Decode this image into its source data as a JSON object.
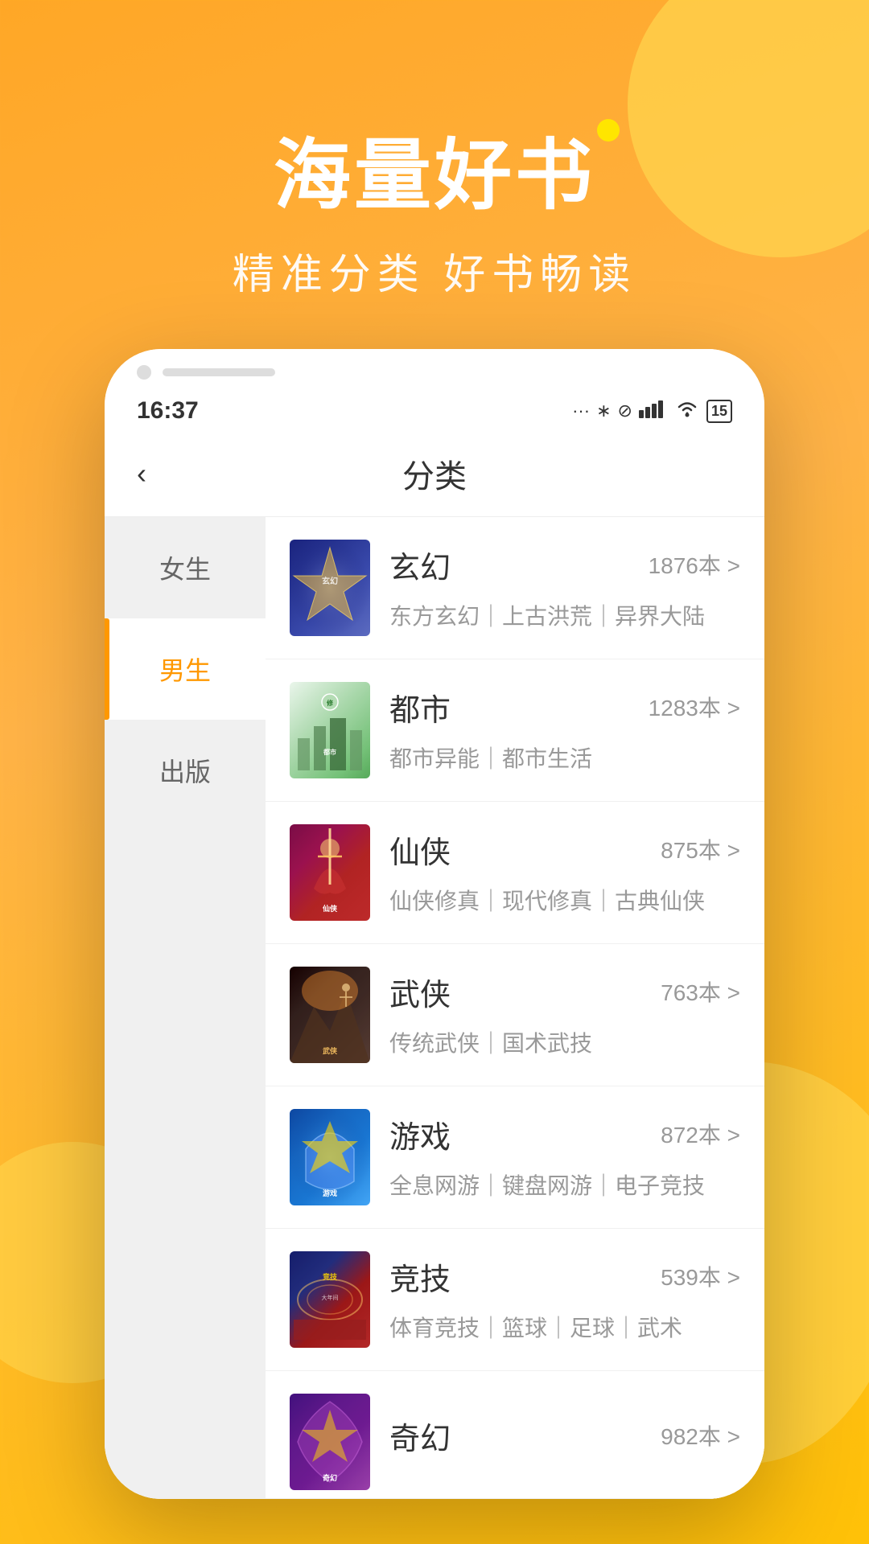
{
  "background": {
    "gradient_start": "#FFA726",
    "gradient_end": "#FFC107",
    "accent_yellow": "#FFD54F"
  },
  "header": {
    "main_title": "海量好书",
    "sub_title": "精准分类 好书畅读"
  },
  "status_bar": {
    "time": "16:37",
    "battery": "15"
  },
  "nav": {
    "back_label": "‹",
    "title": "分类"
  },
  "sidebar": {
    "items": [
      {
        "id": "female",
        "label": "女生",
        "active": false
      },
      {
        "id": "male",
        "label": "男生",
        "active": true
      },
      {
        "id": "publish",
        "label": "出版",
        "active": false
      }
    ]
  },
  "categories": [
    {
      "id": "xuanhuan",
      "name": "玄幻",
      "count": "1876本 >",
      "tags": "东方玄幻｜上古洪荒｜异界大陆",
      "cover_type": "xuanhuan",
      "cover_text": "玄幻"
    },
    {
      "id": "dushi",
      "name": "都市",
      "count": "1283本 >",
      "tags": "都市异能｜都市生活",
      "cover_type": "dushi",
      "cover_text": "都市"
    },
    {
      "id": "xianxia",
      "name": "仙侠",
      "count": "875本 >",
      "tags": "仙侠修真｜现代修真｜古典仙侠",
      "cover_type": "xianxia",
      "cover_text": "仙侠"
    },
    {
      "id": "wuxia",
      "name": "武侠",
      "count": "763本 >",
      "tags": "传统武侠｜国术武技",
      "cover_type": "wuxia",
      "cover_text": "武侠"
    },
    {
      "id": "youxi",
      "name": "游戏",
      "count": "872本 >",
      "tags": "全息网游｜键盘网游｜电子竞技",
      "cover_type": "youxi",
      "cover_text": "游戏"
    },
    {
      "id": "jingji",
      "name": "竞技",
      "count": "539本 >",
      "tags": "体育竞技｜篮球｜足球｜武术",
      "cover_type": "jingji",
      "cover_text": "竞技"
    },
    {
      "id": "qihuan",
      "name": "奇幻",
      "count": "982本 >",
      "tags": "",
      "cover_type": "qihuan",
      "cover_text": "奇幻"
    }
  ]
}
